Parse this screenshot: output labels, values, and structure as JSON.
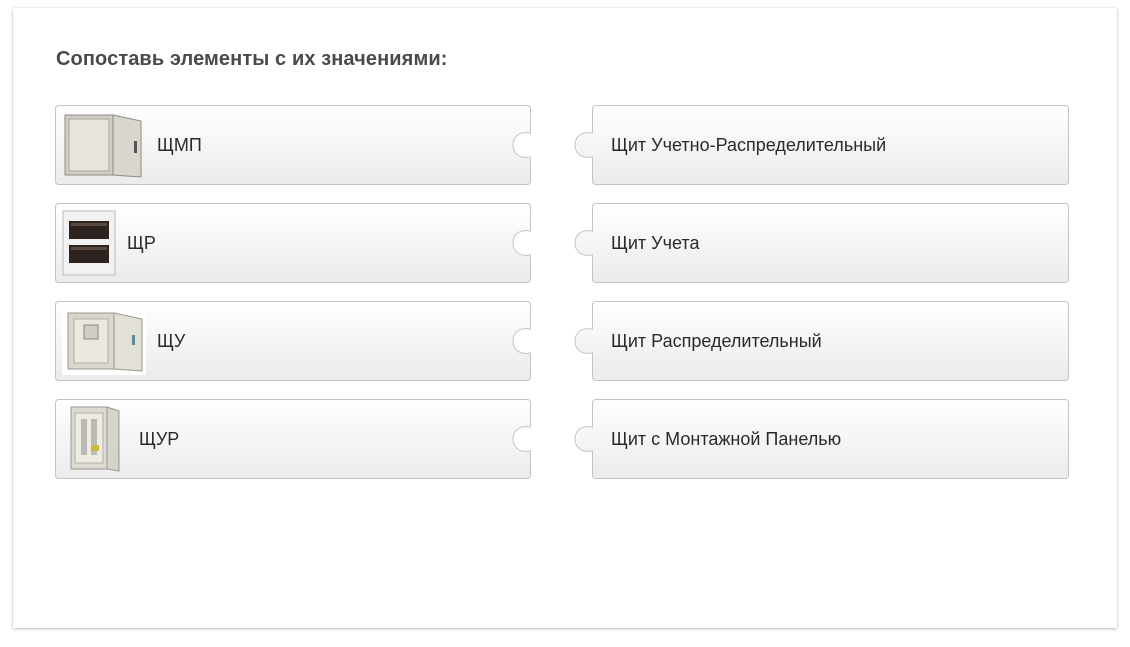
{
  "title": "Сопоставь элементы с их значениями:",
  "left_items": [
    {
      "label": "ЩМП",
      "icon": "wall-cabinet-mounting-panel-icon"
    },
    {
      "label": "ЩР",
      "icon": "distribution-box-icon"
    },
    {
      "label": "ЩУ",
      "icon": "meter-cabinet-icon"
    },
    {
      "label": "ЩУР",
      "icon": "meter-distribution-cabinet-icon"
    }
  ],
  "right_items": [
    {
      "label": "Щит Учетно-Распределительный"
    },
    {
      "label": "Щит Учета"
    },
    {
      "label": "Щит Распределительный"
    },
    {
      "label": "Щит с Монтажной Панелью"
    }
  ],
  "colors": {
    "tile_top": "#ffffff",
    "tile_bottom": "#ececec",
    "tile_border": "#c4c4c4",
    "title_text": "#4a4a4a"
  }
}
